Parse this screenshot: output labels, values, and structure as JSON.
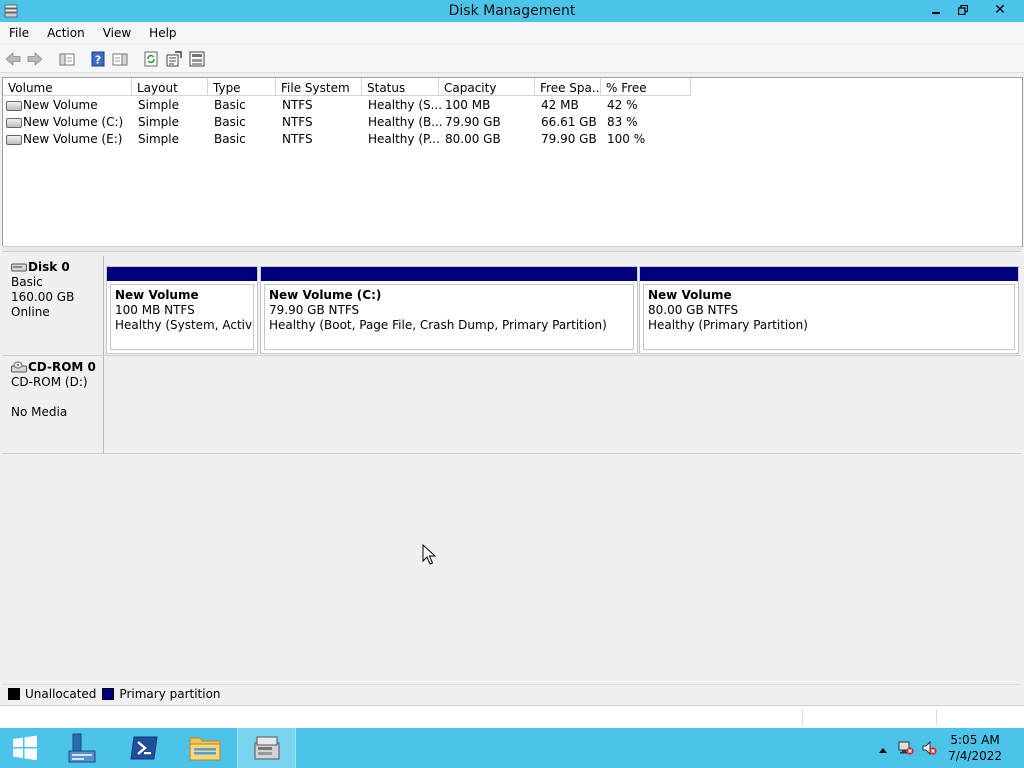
{
  "window": {
    "title": "Disk Management",
    "minimize_icon": "minimize-icon",
    "restore_icon": "restore-icon",
    "close_glyph": "✕"
  },
  "menu": {
    "items": [
      "File",
      "Action",
      "View",
      "Help"
    ]
  },
  "toolbar": {
    "icons": [
      "back-arrow-icon",
      "forward-arrow-icon",
      "show-hide-console-tree-icon",
      "help-icon",
      "action-pane-icon",
      "refresh-icon",
      "properties-icon",
      "disk-properties-icon"
    ]
  },
  "volume_list": {
    "columns": [
      "Volume",
      "Layout",
      "Type",
      "File System",
      "Status",
      "Capacity",
      "Free Spa...",
      "% Free"
    ],
    "rows": [
      [
        "New Volume",
        "Simple",
        "Basic",
        "NTFS",
        "Healthy (S...",
        "100 MB",
        "42 MB",
        "42 %"
      ],
      [
        "New Volume (C:)",
        "Simple",
        "Basic",
        "NTFS",
        "Healthy (B...",
        "79.90 GB",
        "66.61 GB",
        "83 %"
      ],
      [
        "New Volume (E:)",
        "Simple",
        "Basic",
        "NTFS",
        "Healthy (P...",
        "80.00 GB",
        "79.90 GB",
        "100 %"
      ]
    ]
  },
  "disks": {
    "disk0": {
      "name": "Disk 0",
      "type": "Basic",
      "size": "160.00 GB",
      "state": "Online",
      "partitions": [
        {
          "name": "New Volume",
          "size_fs": "100 MB NTFS",
          "status": "Healthy (System, Active, P"
        },
        {
          "name": "New Volume  (C:)",
          "size_fs": "79.90 GB NTFS",
          "status": "Healthy (Boot, Page File, Crash Dump, Primary Partition)"
        },
        {
          "name": "New Volume",
          "size_fs": "80.00 GB NTFS",
          "status": "Healthy (Primary Partition)"
        }
      ]
    },
    "cdrom0": {
      "name": "CD-ROM 0",
      "drive": "CD-ROM (D:)",
      "media": "No Media"
    }
  },
  "legend": {
    "items": [
      {
        "label": "Unallocated",
        "color": "#000000"
      },
      {
        "label": "Primary partition",
        "color": "#00007e"
      }
    ]
  },
  "taskbar": {
    "buttons": [
      "windows-start-icon",
      "server-manager-icon",
      "powershell-icon",
      "file-explorer-icon",
      "disk-management-icon"
    ],
    "clock_time": "5:05 AM",
    "clock_date": "7/4/2022",
    "tray_icons": [
      "show-hidden-icons-icon",
      "network-icon",
      "volume-muted-icon"
    ]
  },
  "colors": {
    "titlebar": "#4cc3e8",
    "primary_partition": "#00007e"
  }
}
